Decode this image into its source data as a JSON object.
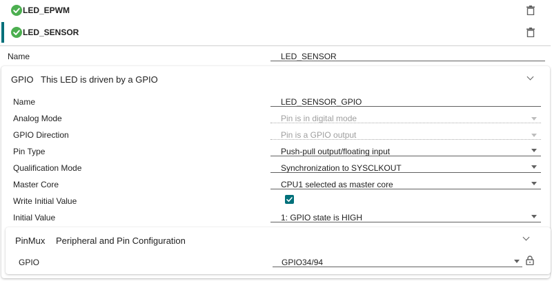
{
  "items": [
    {
      "label": "LED_EPWM",
      "status": "ok"
    },
    {
      "label": "LED_SENSOR",
      "status": "ok"
    }
  ],
  "colors": {
    "accent": "#00707a",
    "ok": "#4caf50"
  },
  "name_field": {
    "label": "Name",
    "value": "LED_SENSOR"
  },
  "gpio": {
    "title": "GPIO",
    "description": "This LED is driven by a GPIO",
    "fields": [
      {
        "label": "Name",
        "value": "LED_SENSOR_GPIO"
      },
      {
        "label": "Analog Mode",
        "value": "Pin is in digital mode"
      },
      {
        "label": "GPIO Direction",
        "value": "Pin is a GPIO output"
      },
      {
        "label": "Pin Type",
        "value": "Push-pull output/floating input"
      },
      {
        "label": "Qualification Mode",
        "value": "Synchronization to SYSCLKOUT"
      },
      {
        "label": "Master Core",
        "value": "CPU1 selected as master core"
      },
      {
        "label": "Write Initial Value",
        "checked": true
      },
      {
        "label": "Initial Value",
        "value": "1: GPIO state is HIGH"
      }
    ]
  },
  "pinmux": {
    "title": "PinMux",
    "description": "Peripheral and Pin Configuration",
    "field_label": "GPIO",
    "field_value": "GPIO34/94"
  },
  "icons": {
    "status": "check-circle-icon",
    "delete": "trash-icon",
    "expand": "chevron-down-icon",
    "lock": "lock-icon",
    "dropdown": "dropdown-arrow-icon"
  }
}
